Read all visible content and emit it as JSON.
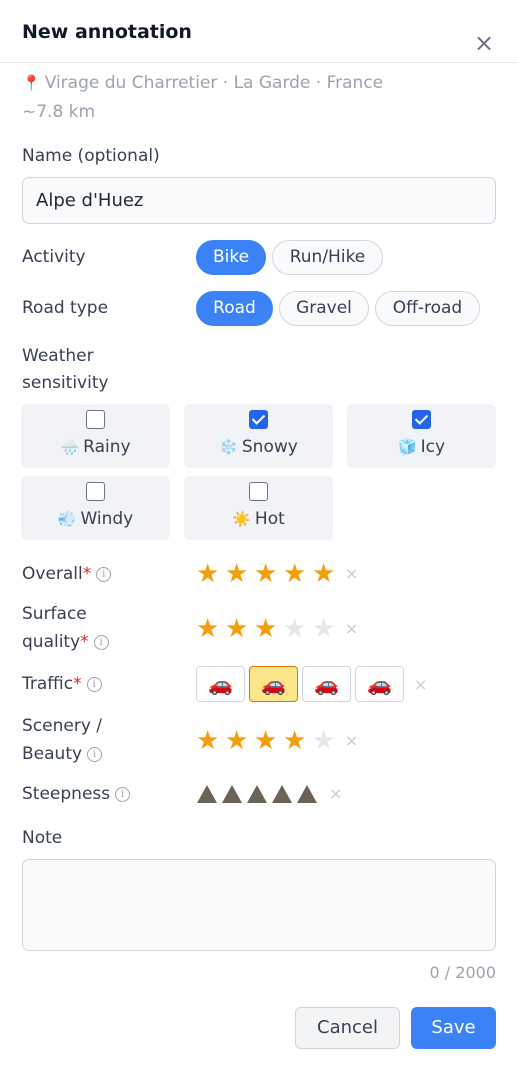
{
  "dialog": {
    "title": "New annotation",
    "close_symbol": "×"
  },
  "location": {
    "pin_icon": "📍",
    "text": "Virage du Charretier · La Garde · France",
    "distance": "~7.8 km"
  },
  "name_field": {
    "label": "Name (optional)",
    "value": "Alpe d'Huez"
  },
  "activity": {
    "label": "Activity",
    "options": [
      "Bike",
      "Run/Hike"
    ],
    "selected": "Bike"
  },
  "road_type": {
    "label": "Road type",
    "options": [
      "Road",
      "Gravel",
      "Off-road"
    ],
    "selected": "Road"
  },
  "weather": {
    "label_line1": "Weather",
    "label_line2": "sensitivity",
    "options": [
      {
        "icon": "🌧️",
        "label": "Rainy",
        "checked": false
      },
      {
        "icon": "❄️",
        "label": "Snowy",
        "checked": true
      },
      {
        "icon": "🧊",
        "label": "Icy",
        "checked": true
      },
      {
        "icon": "💨",
        "label": "Windy",
        "checked": false
      },
      {
        "icon": "☀️",
        "label": "Hot",
        "checked": false
      }
    ]
  },
  "ratings": {
    "overall": {
      "label": "Overall",
      "required_mark": "*",
      "value": 5,
      "max": 5
    },
    "surface": {
      "label_line1": "Surface",
      "label_line2": "quality",
      "required_mark": "*",
      "value": 3,
      "max": 5
    },
    "traffic": {
      "label": "Traffic",
      "required_mark": "*",
      "value": 2,
      "max": 4,
      "icon": "car-icon"
    },
    "scenery": {
      "label_line1": "Scenery /",
      "label_line2": "Beauty",
      "value": 4,
      "max": 5
    },
    "steepness": {
      "label": "Steepness",
      "value": 5,
      "max": 5,
      "icon": "triangle-icon"
    },
    "clear_symbol": "×",
    "info_symbol": "i"
  },
  "note": {
    "label": "Note",
    "value": "",
    "count": "0 / 2000"
  },
  "buttons": {
    "cancel": "Cancel",
    "save": "Save"
  },
  "colors": {
    "accent": "#3b82f6",
    "star": "#f59e0b",
    "required": "#dc2626",
    "traffic_selected": "#fde68a"
  }
}
